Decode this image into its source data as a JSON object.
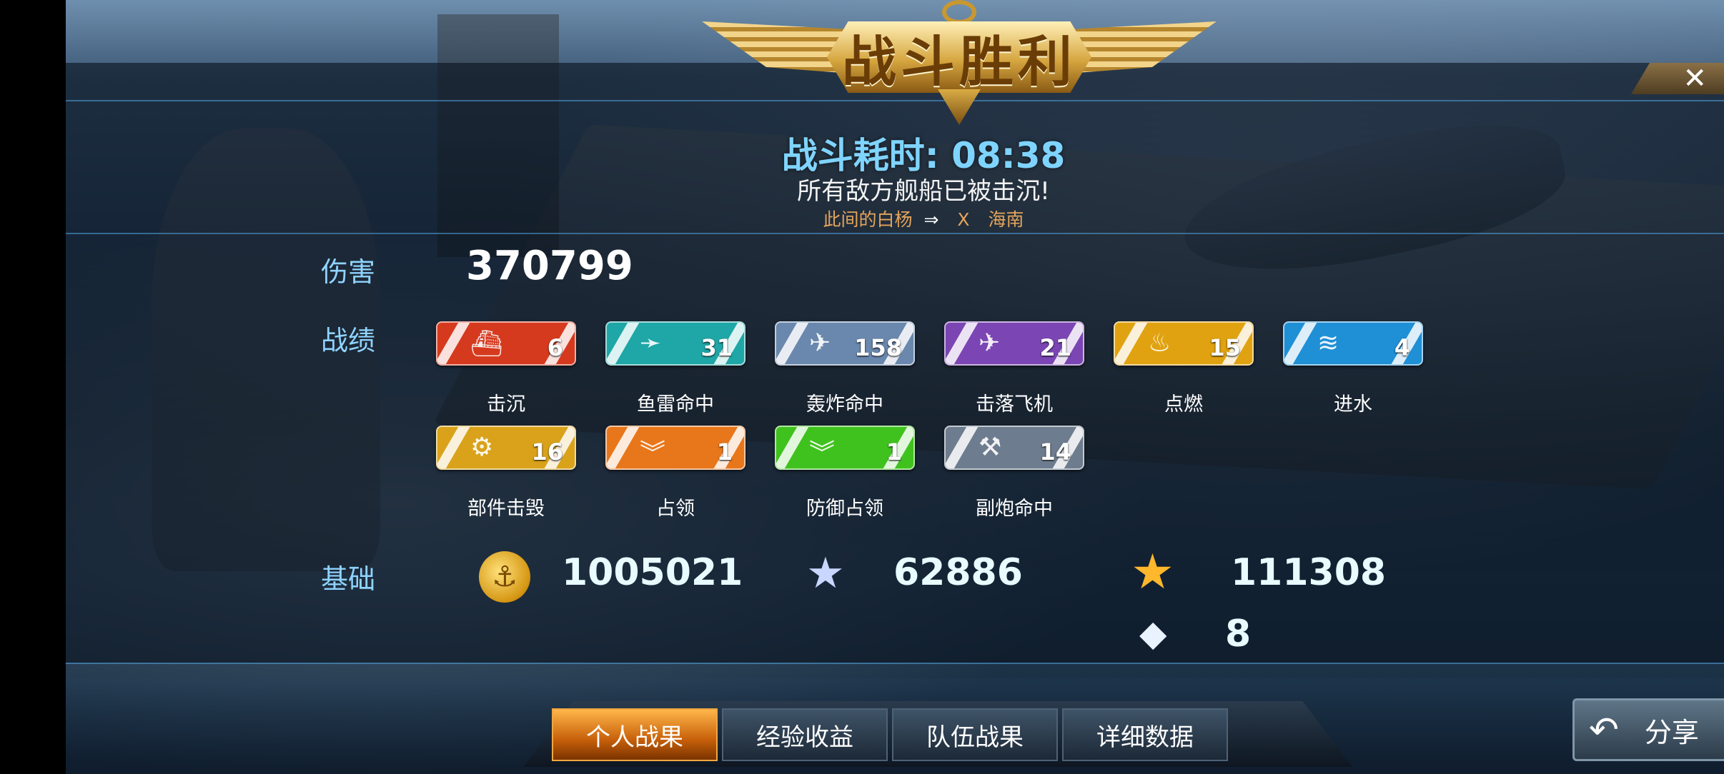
{
  "header": {
    "title": "战斗胜利",
    "close_icon": "close-icon"
  },
  "summary": {
    "battle_time": "战斗耗时: 08:38",
    "result_message": "所有敌方舰船已被击沉!",
    "player_left": "此间的白杨",
    "vs_icon": "versus-icon",
    "separator": "X",
    "player_right": "海南"
  },
  "damage": {
    "label": "伤害",
    "value": "370799"
  },
  "record": {
    "label": "战绩",
    "badges": [
      {
        "name": "击沉",
        "count": "6",
        "color": "#d63a1e",
        "icon": "ship-sink-icon"
      },
      {
        "name": "鱼雷命中",
        "count": "31",
        "color": "#1fa6a6",
        "icon": "torpedo-icon"
      },
      {
        "name": "轰炸命中",
        "count": "158",
        "color": "#6a88ad",
        "icon": "bomber-icon"
      },
      {
        "name": "击落飞机",
        "count": "21",
        "color": "#7b46b3",
        "icon": "aircraft-icon"
      },
      {
        "name": "点燃",
        "count": "15",
        "color": "#e0a210",
        "icon": "fire-icon"
      },
      {
        "name": "进水",
        "count": "4",
        "color": "#1f8fd6",
        "icon": "flood-icon"
      },
      {
        "name": "部件击毁",
        "count": "16",
        "color": "#d9a21a",
        "icon": "gear-icon"
      },
      {
        "name": "占领",
        "count": "1",
        "color": "#e8761a",
        "icon": "capture-chevron-icon"
      },
      {
        "name": "防御占领",
        "count": "1",
        "color": "#3fc21e",
        "icon": "defend-chevron-icon"
      },
      {
        "name": "副炮命中",
        "count": "14",
        "color": "#6d7c8e",
        "icon": "secondary-gun-icon"
      }
    ]
  },
  "base": {
    "label": "基础",
    "coins": "1005021",
    "silver_exp": "62886",
    "gold_exp": "111308",
    "diamonds": "8"
  },
  "nav": {
    "tabs": [
      "个人战果",
      "经验收益",
      "队伍战果",
      "详细数据"
    ],
    "active_index": 0,
    "share_label": "分享"
  },
  "icons": {
    "coin": "anchor-coin-icon",
    "silver_star": "silver-star-icon",
    "gold_star": "gold-star-icon",
    "diamond": "diamond-icon",
    "share": "share-arrow-icon"
  }
}
